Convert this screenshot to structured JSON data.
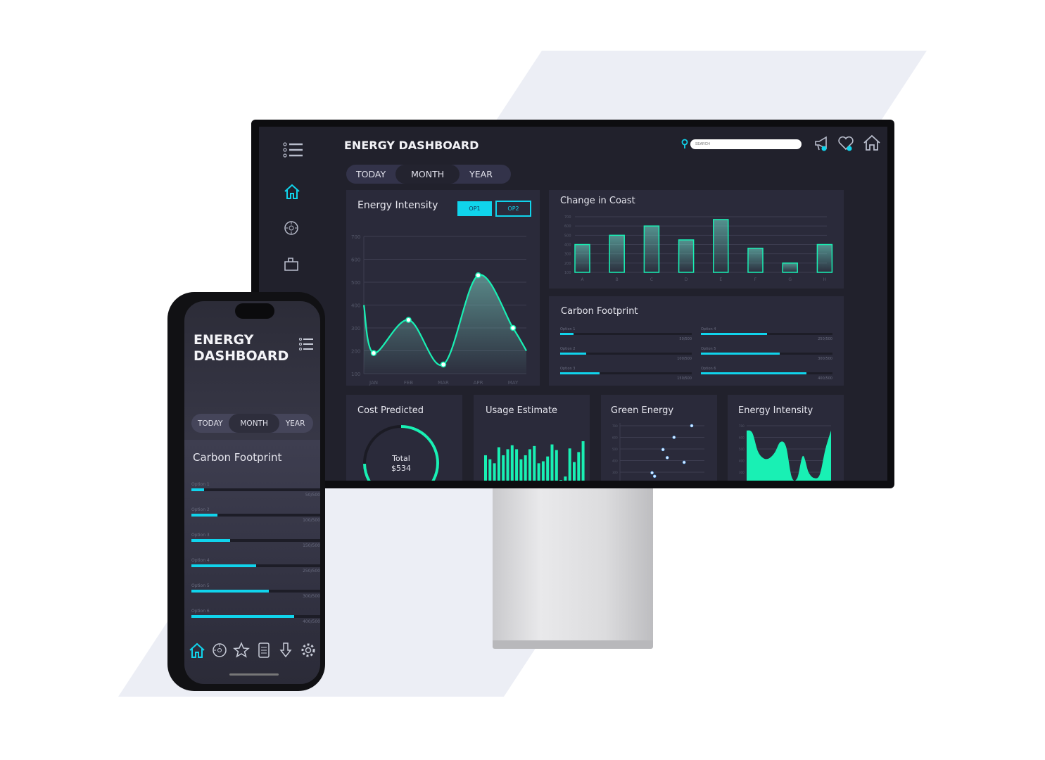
{
  "colors": {
    "accent": "#19f0b4",
    "cyan": "#10d4ec",
    "panel": "#2a2a3a",
    "screen": "#21212c"
  },
  "desktop": {
    "title": "ENERGY DASHBOARD",
    "search": {
      "placeholder": "SEARCH"
    },
    "header_icons": [
      "location-pin-icon",
      "megaphone-icon",
      "heart-icon",
      "home-icon"
    ],
    "sidebar_icons": [
      "menu-icon",
      "home-icon",
      "dial-icon",
      "bag-icon"
    ],
    "tabs": [
      {
        "label": "TODAY"
      },
      {
        "label": "MONTH",
        "active": true
      },
      {
        "label": "YEAR"
      }
    ],
    "energy_intensity": {
      "title": "Energy Intensity",
      "op1": "OP1",
      "op2": "OP2"
    },
    "change_in_cost": {
      "title": "Change in Coast"
    },
    "carbon_footprint": {
      "title": "Carbon Footprint"
    },
    "cost_predicted": {
      "title": "Cost Predicted",
      "total_label": "Total",
      "total_value": "$534",
      "progress": 0.75
    },
    "usage_estimate": {
      "title": "Usage Estimate"
    },
    "green_energy": {
      "title": "Green Energy"
    },
    "energy_intensity_small": {
      "title": "Energy Intensity"
    }
  },
  "phone": {
    "title_line1": "ENERGY",
    "title_line2": "DASHBOARD",
    "tabs": [
      {
        "label": "TODAY"
      },
      {
        "label": "MONTH",
        "active": true
      },
      {
        "label": "YEAR"
      }
    ],
    "carbon_title": "Carbon Footprint",
    "nav_icons": [
      "home-icon",
      "dial-icon",
      "star-icon",
      "document-icon",
      "download-icon",
      "gear-icon"
    ]
  },
  "chart_data": [
    {
      "id": "energy_intensity",
      "type": "area",
      "title": "Energy Intensity",
      "categories": [
        "JAN",
        "FEB",
        "MAR",
        "APR",
        "MAY"
      ],
      "values": [
        190,
        335,
        140,
        530,
        300
      ],
      "ylim": [
        100,
        700
      ],
      "yticks": [
        "100",
        "200",
        "300",
        "400",
        "500",
        "600",
        "700"
      ],
      "grid": true
    },
    {
      "id": "change_in_cost",
      "type": "bar",
      "title": "Change in Coast",
      "categories": [
        "A",
        "B",
        "C",
        "D",
        "E",
        "F",
        "G",
        "H"
      ],
      "values": [
        400,
        500,
        600,
        450,
        670,
        360,
        200,
        400
      ],
      "ylim": [
        100,
        700
      ],
      "yticks": [
        "100",
        "200",
        "300",
        "400",
        "500",
        "600",
        "700"
      ],
      "grid": true
    },
    {
      "id": "carbon_footprint",
      "type": "bar",
      "title": "Carbon Footprint",
      "categories": [
        "Option 1",
        "Option 2",
        "Option 3",
        "Option 4",
        "Option 5",
        "Option 6"
      ],
      "values": [
        50,
        100,
        150,
        250,
        300,
        400
      ],
      "max": 500,
      "value_labels": [
        "50/500",
        "100/500",
        "150/500",
        "250/500",
        "300/500",
        "400/500"
      ]
    },
    {
      "id": "usage_estimate",
      "type": "bar",
      "title": "Usage Estimate",
      "values": [
        0.65,
        0.55,
        0.45,
        0.85,
        0.65,
        0.8,
        0.9,
        0.8,
        0.55,
        0.65,
        0.8,
        0.88,
        0.45,
        0.5,
        0.62,
        0.92,
        0.78,
        0.02,
        0.12,
        0.82,
        0.48,
        0.73,
        1.0
      ]
    },
    {
      "id": "green_energy",
      "type": "scatter",
      "title": "Green Energy",
      "x": [
        0.85,
        0.64,
        0.51,
        0.56,
        0.76,
        0.38,
        0.41
      ],
      "y": [
        700,
        600,
        495,
        425,
        385,
        295,
        265
      ],
      "yticks": [
        "300",
        "400",
        "500",
        "600",
        "700"
      ],
      "grid": true
    },
    {
      "id": "energy_intensity_small",
      "type": "area",
      "title": "Energy Intensity",
      "values": [
        660,
        640,
        480,
        420,
        420,
        470,
        560,
        520,
        260,
        250,
        440,
        300,
        250,
        280,
        500,
        660
      ],
      "yticks": [
        "300",
        "400",
        "500",
        "600",
        "700"
      ],
      "grid": true
    }
  ]
}
